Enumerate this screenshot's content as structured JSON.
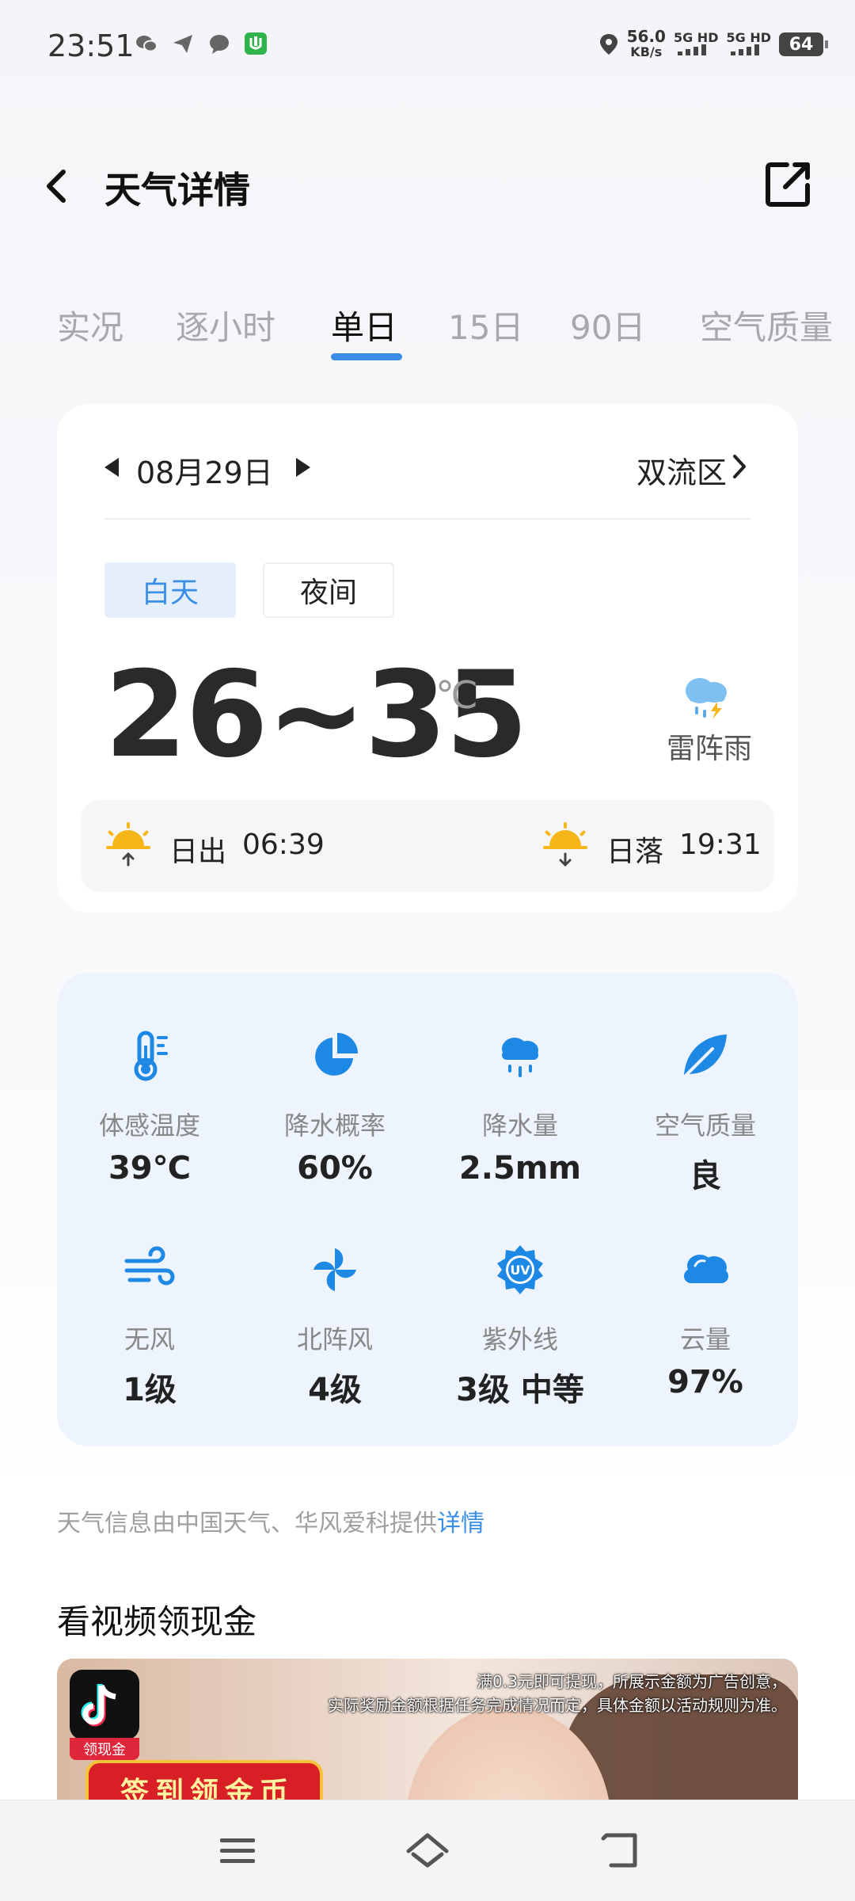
{
  "status_bar": {
    "time": "23:51",
    "speed_value": "56.0",
    "speed_unit": "KB/s",
    "signal_1": "5G HD",
    "signal_2": "5G HD",
    "battery": "64"
  },
  "header": {
    "title": "天气详情"
  },
  "tabs": [
    {
      "label": "实况"
    },
    {
      "label": "逐小时"
    },
    {
      "label": "单日"
    },
    {
      "label": "15日"
    },
    {
      "label": "90日"
    },
    {
      "label": "空气质量"
    }
  ],
  "active_tab": "单日",
  "day_card": {
    "date": "08月29日",
    "district": "双流区",
    "segment_day": "白天",
    "segment_night": "夜间",
    "temp_range": "26~35",
    "temp_unit": "℃",
    "condition": "雷阵雨",
    "sunrise_label": "日出",
    "sunrise_time": "06:39",
    "sunset_label": "日落",
    "sunset_time": "19:31"
  },
  "metrics": [
    {
      "label": "体感温度",
      "value": "39℃",
      "icon": "thermometer-icon"
    },
    {
      "label": "降水概率",
      "value": "60%",
      "icon": "pie-chart-icon"
    },
    {
      "label": "降水量",
      "value": "2.5mm",
      "icon": "rain-cloud-icon"
    },
    {
      "label": "空气质量",
      "value": "良",
      "icon": "leaf-icon"
    },
    {
      "label": "无风",
      "value": "1级",
      "icon": "wind-icon"
    },
    {
      "label": "北阵风",
      "value": "4级",
      "icon": "pinwheel-icon"
    },
    {
      "label": "紫外线",
      "value": "3级 中等",
      "icon": "uv-icon"
    },
    {
      "label": "云量",
      "value": "97%",
      "icon": "cloud-icon"
    }
  ],
  "source": {
    "text": "天气信息由中国天气、华风爱科提供",
    "link": "详情"
  },
  "promo": {
    "title": "看视频领现金",
    "note_line1": "满0.3元即可提现，所展示金额为广告创意，",
    "note_line2": "实际奖励金额根据任务完成情况而定，具体金额以活动规则为准。",
    "app_badge": "领现金",
    "checkin": "签到领金币"
  },
  "colors": {
    "accent": "#3a8ee6",
    "metrics_bg": "#eef4fd"
  }
}
